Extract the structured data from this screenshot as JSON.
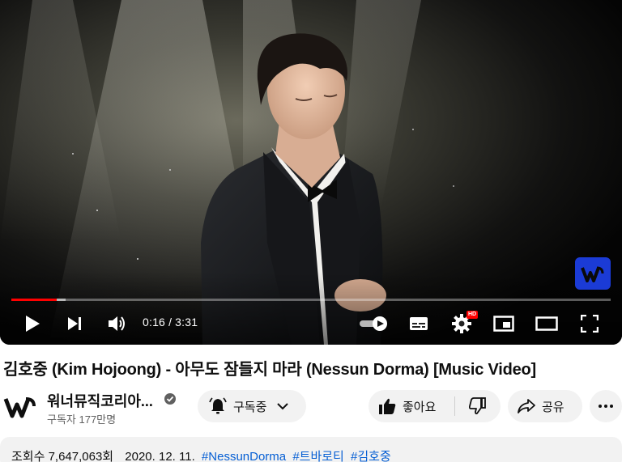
{
  "player": {
    "current_time": "0:16",
    "duration": "3:31",
    "time_separator": "/",
    "progress_fraction": 0.076,
    "loaded_fraction": 0.09,
    "quality_badge": "HD",
    "icons": [
      "play-icon",
      "next-icon",
      "volume-icon",
      "autoplay-toggle",
      "subtitles-icon",
      "settings-icon",
      "miniplayer-icon",
      "theater-mode-icon",
      "fullscreen-icon"
    ],
    "accent_color": "#ff0000",
    "watermark_color": "#1b3bd6"
  },
  "video": {
    "title": "김호중 (Kim Hojoong) - 아무도 잠들지 마라 (Nessun Dorma) [Music Video]"
  },
  "channel": {
    "name": "워너뮤직코리아...",
    "subscribers": "구독자 177만명"
  },
  "actions": {
    "subscribe_label": "구독중",
    "like_label": "좋아요",
    "share_label": "공유"
  },
  "description": {
    "views": "조회수 7,647,063회",
    "date": "2020. 12. 11.",
    "hashtags": [
      "#NessunDorma",
      "#트바로티",
      "#김호중"
    ],
    "link_color": "#065fd4"
  }
}
